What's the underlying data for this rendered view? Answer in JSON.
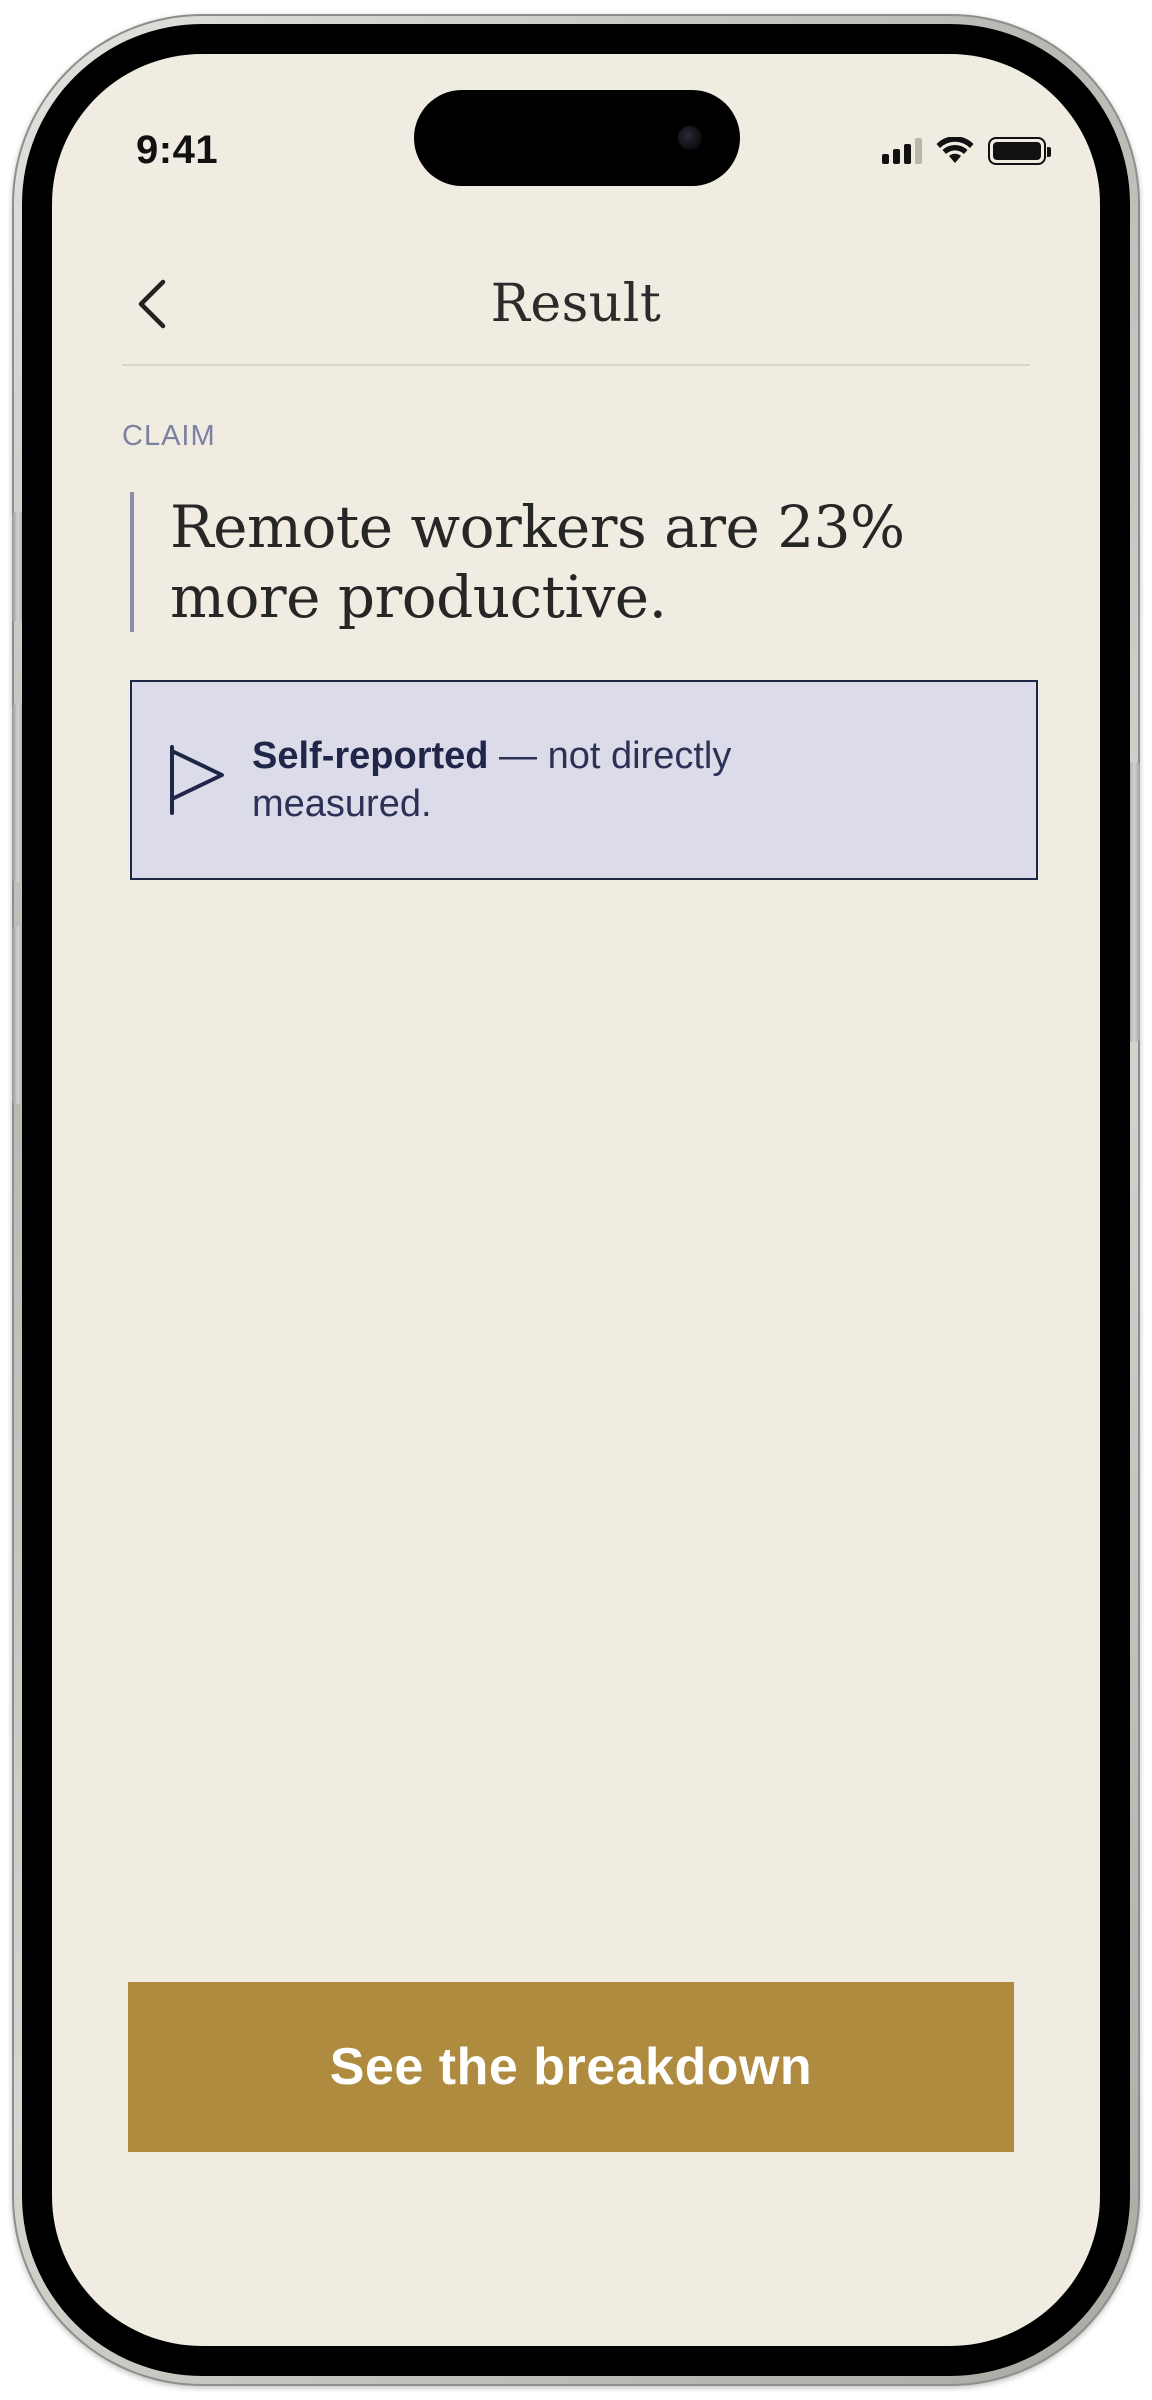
{
  "status_bar": {
    "time": "9:41",
    "icons": [
      "cellular-signal-icon",
      "wifi-icon",
      "battery-icon"
    ]
  },
  "header": {
    "title": "Result",
    "back_icon": "chevron-left-icon"
  },
  "claim": {
    "label": "CLAIM",
    "text": "Remote workers are 23% more productive."
  },
  "verdict": {
    "icon": "flag-icon",
    "strong": "Self-reported",
    "rest": " — not directly measured."
  },
  "cta": {
    "label": "See the breakdown"
  },
  "colors": {
    "background": "#f0ece2",
    "verdict_bg": "#dcdbea",
    "verdict_border": "#1f2648",
    "cta": "#ae8b3e",
    "label": "#7d81a0"
  }
}
